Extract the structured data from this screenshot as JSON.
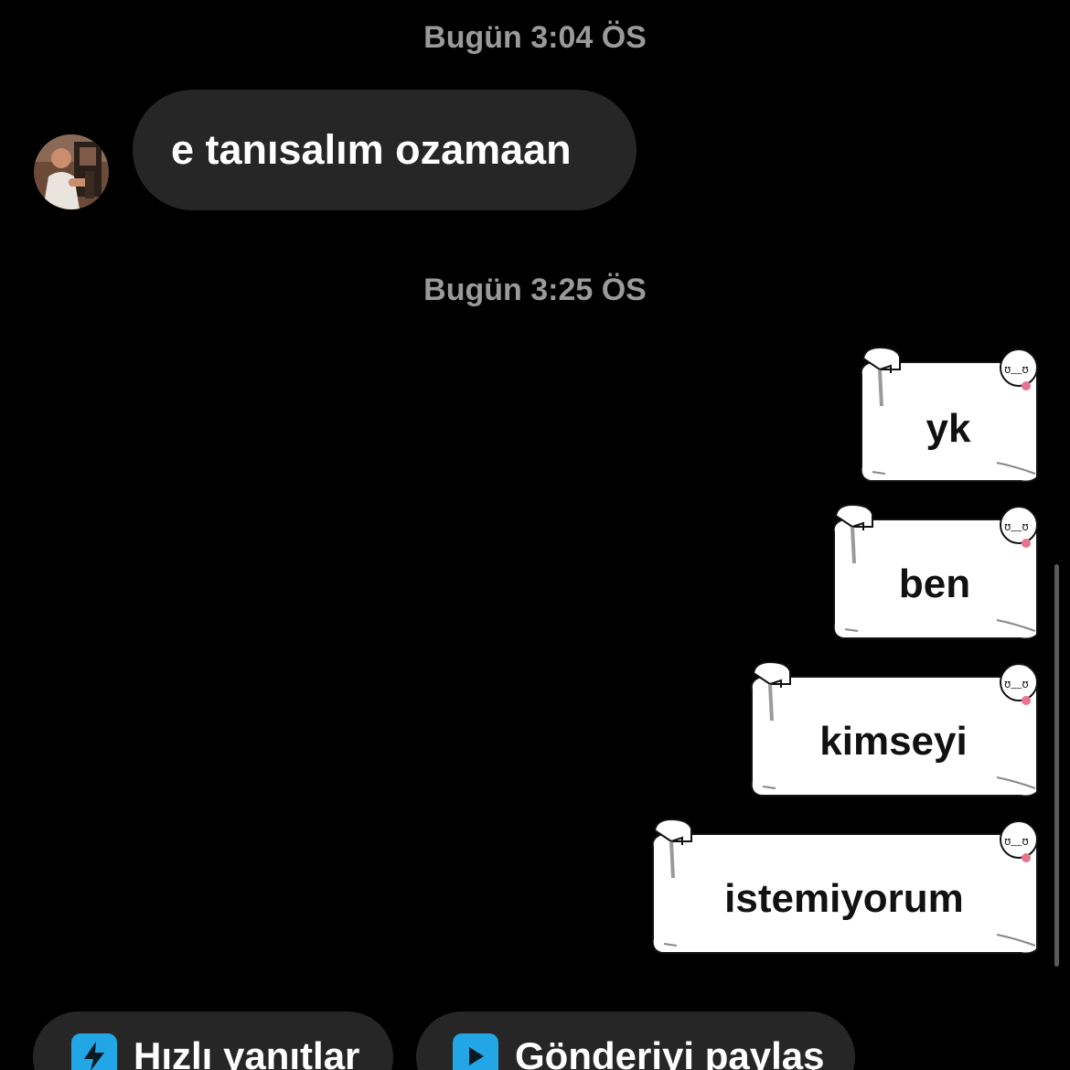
{
  "conversation": {
    "timestamps": [
      "Bugün 3:04 ÖS",
      "Bugün 3:25 ÖS"
    ],
    "incoming": [
      {
        "text": "e tanısalım ozamaan"
      }
    ],
    "outgoing_stickers": [
      {
        "text": "yk"
      },
      {
        "text": "ben"
      },
      {
        "text": "kimseyi"
      },
      {
        "text": "istemiyorum"
      }
    ]
  },
  "actions": {
    "quick_replies": {
      "label": "Hızlı yanıtlar",
      "icon": "lightning-icon"
    },
    "share_post": {
      "label": "Gönderiyi paylaş",
      "icon": "play-icon"
    }
  },
  "colors": {
    "background": "#000000",
    "incoming_bubble": "#262626",
    "timestamp": "#9a9a9a",
    "accent_icon": "#23a6e6"
  }
}
